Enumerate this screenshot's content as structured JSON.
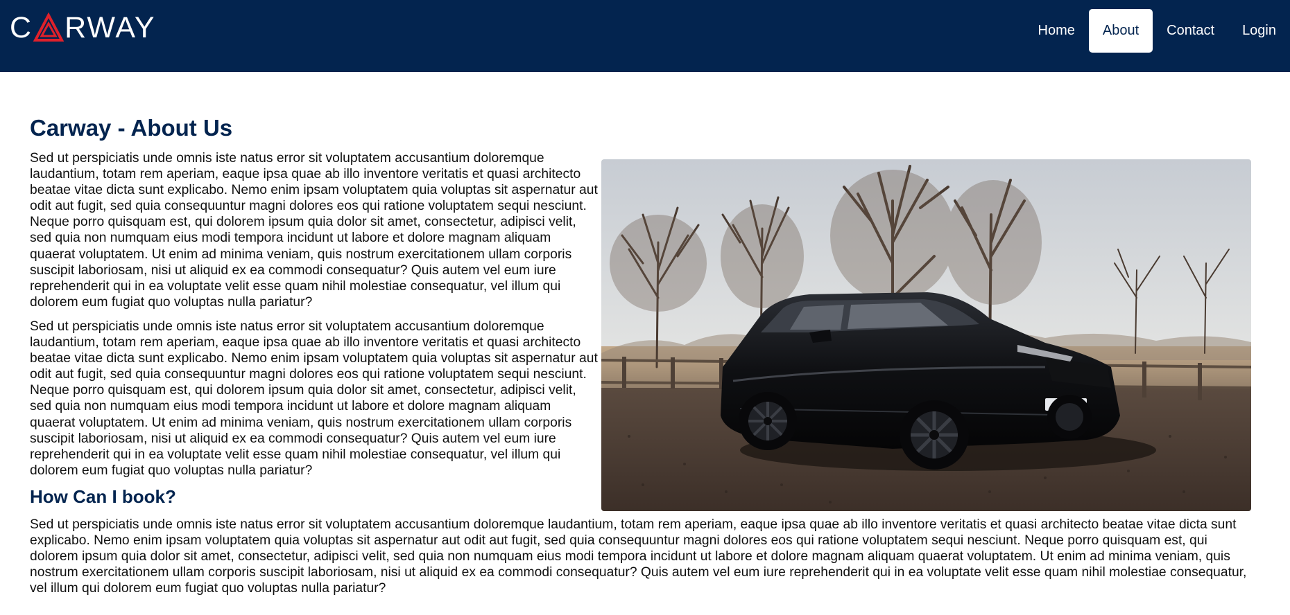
{
  "brand": {
    "logo_text_left": "C",
    "logo_text_right": "RWAY",
    "accent": "#e0212b"
  },
  "colors": {
    "navbar_bg": "#03244f",
    "heading": "#03244f"
  },
  "nav": {
    "items": [
      {
        "label": "Home",
        "active": false
      },
      {
        "label": "About",
        "active": true
      },
      {
        "label": "Contact",
        "active": false
      },
      {
        "label": "Login",
        "active": false
      }
    ]
  },
  "main": {
    "title": "Carway - About Us",
    "paragraph1": "Sed ut perspiciatis unde omnis iste natus error sit voluptatem accusantium doloremque laudantium, totam rem aperiam, eaque ipsa quae ab illo inventore veritatis et quasi architecto beatae vitae dicta sunt explicabo. Nemo enim ipsam voluptatem quia voluptas sit aspernatur aut odit aut fugit, sed quia consequuntur magni dolores eos qui ratione voluptatem sequi nesciunt. Neque porro quisquam est, qui dolorem ipsum quia dolor sit amet, consectetur, adipisci velit, sed quia non numquam eius modi tempora incidunt ut labore et dolore magnam aliquam quaerat voluptatem. Ut enim ad minima veniam, quis nostrum exercitationem ullam corporis suscipit laboriosam, nisi ut aliquid ex ea commodi consequatur? Quis autem vel eum iure reprehenderit qui in ea voluptate velit esse quam nihil molestiae consequatur, vel illum qui dolorem eum fugiat quo voluptas nulla pariatur?",
    "paragraph2": "Sed ut perspiciatis unde omnis iste natus error sit voluptatem accusantium doloremque laudantium, totam rem aperiam, eaque ipsa quae ab illo inventore veritatis et quasi architecto beatae vitae dicta sunt explicabo. Nemo enim ipsam voluptatem quia voluptas sit aspernatur aut odit aut fugit, sed quia consequuntur magni dolores eos qui ratione voluptatem sequi nesciunt. Neque porro quisquam est, qui dolorem ipsum quia dolor sit amet, consectetur, adipisci velit, sed quia non numquam eius modi tempora incidunt ut labore et dolore magnam aliquam quaerat voluptatem. Ut enim ad minima veniam, quis nostrum exercitationem ullam corporis suscipit laboriosam, nisi ut aliquid ex ea commodi consequatur? Quis autem vel eum iure reprehenderit qui in ea voluptate velit esse quam nihil molestiae consequatur, vel illum qui dolorem eum fugiat quo voluptas nulla pariatur?",
    "subtitle": "How Can I book?",
    "paragraph3": "Sed ut perspiciatis unde omnis iste natus error sit voluptatem accusantium doloremque laudantium, totam rem aperiam, eaque ipsa quae ab illo inventore veritatis et quasi architecto beatae vitae dicta sunt explicabo. Nemo enim ipsam voluptatem quia voluptas sit aspernatur aut odit aut fugit, sed quia consequuntur magni dolores eos qui ratione voluptatem sequi nesciunt. Neque porro quisquam est, qui dolorem ipsum quia dolor sit amet, consectetur, adipisci velit, sed quia non numquam eius modi tempora incidunt ut labore et dolore magnam aliquam quaerat voluptatem. Ut enim ad minima veniam, quis nostrum exercitationem ullam corporis suscipit laboriosam, nisi ut aliquid ex ea commodi consequatur? Quis autem vel eum iure reprehenderit qui in ea voluptate velit esse quam nihil molestiae consequatur, vel illum qui dolorem eum fugiat quo voluptas nulla pariatur?"
  }
}
